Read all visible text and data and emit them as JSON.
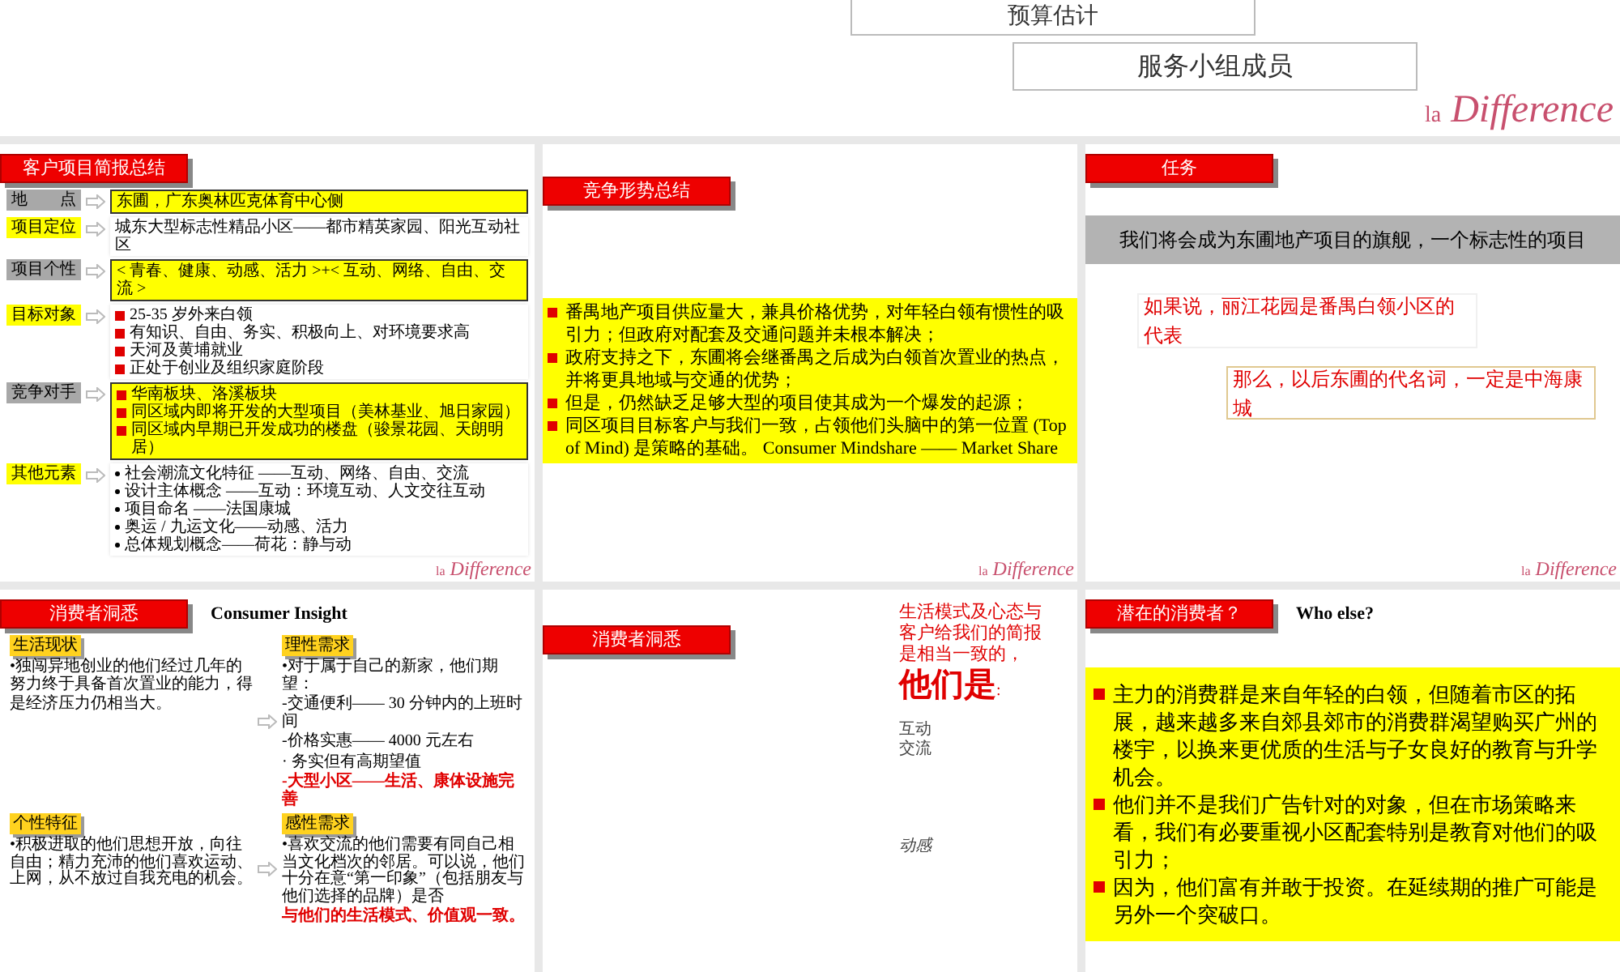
{
  "top_slide": {
    "boxes": [
      "预算估计",
      "服务小组成员"
    ],
    "logo": {
      "prefix": "la",
      "word": "Difference"
    }
  },
  "slides": [
    {
      "kind": "brief",
      "title": "客户项目简报总结",
      "logo": {
        "prefix": "la",
        "word": "Difference"
      },
      "rows": [
        {
          "label": "地　　点",
          "highlight": true,
          "kind": "plain",
          "lines": [
            "东圃，广东奥林匹克体育中心侧"
          ]
        },
        {
          "label": "项目定位",
          "highlight": false,
          "kind": "plain",
          "lines": [
            "城东大型标志性精品小区——都市精英家园、阳光互动社区"
          ]
        },
        {
          "label": "项目个性",
          "highlight": true,
          "kind": "plain",
          "lines": [
            "< 青春、健康、动感、活力 >+< 互动、网络、自由、交流 >"
          ]
        },
        {
          "label": "目标对象",
          "highlight": false,
          "kind": "square",
          "lines": [
            "25-35 岁外来白领",
            "有知识、自由、务实、积极向上、对环境要求高",
            "天河及黄埔就业",
            "正处于创业及组织家庭阶段"
          ]
        },
        {
          "label": "竞争对手",
          "highlight": true,
          "kind": "square",
          "lines": [
            "华南板块、洛溪板块",
            "同区域内即将开发的大型项目（美林基业、旭日家园）",
            "同区域内早期已开发成功的楼盘（骏景花园、天朗明居）"
          ]
        },
        {
          "label": "其他元素",
          "highlight": false,
          "kind": "dot",
          "lines": [
            "社会潮流文化特征 ——互动、网络、自由、交流",
            "设计主体概念 ——互动：环境互动、人文交往互动",
            "项目命名 ——法国康城",
            "奥运 / 九运文化——动感、活力",
            "总体规划概念——荷花：静与动"
          ]
        }
      ]
    },
    {
      "kind": "bullets",
      "title": "竞争形势总结",
      "logo": {
        "prefix": "la",
        "word": "Difference"
      },
      "items": [
        "番禺地产项目供应量大，兼具价格优势，对年轻白领有惯性的吸引力；但政府对配套及交通问题并未根本解决；",
        "政府支持之下，东圃将会继番禺之后成为白领首次置业的热点，并将更具地域与交通的优势；",
        "但是，仍然缺乏足够大型的项目使其成为一个爆发的起源；",
        "同区项目目标客户与我们一致，占领他们头脑中的第一位置 (Top of Mind) 是策略的基础。 Consumer Mindshare —— Market Share"
      ]
    },
    {
      "kind": "task",
      "title": "任务",
      "logo": {
        "prefix": "la",
        "word": "Difference"
      },
      "banner": "我们将会成为东圃地产项目的旗舰，一个标志性的项目",
      "statements": [
        "如果说，丽江花园是番禺白领小区的代表",
        "那么，以后东圃的代名词，一定是中海康城"
      ]
    },
    {
      "kind": "insight",
      "title": "消费者洞悉",
      "subtitle": "Consumer Insight",
      "quadrants": [
        {
          "tag": "生活现状",
          "lines": [
            {
              "text": "•独闯异地创业的他们经过几年的努力终于具备首次置业的能力，得",
              "red": false
            },
            {
              "text": "是经济压力仍相当大。",
              "red": false
            }
          ]
        },
        {
          "tag": "理性需求",
          "lines": [
            {
              "text": "•对于属于自己的新家，他们期望：",
              "red": false
            },
            {
              "text": "-交通便利—— 30 分钟内的上班时间",
              "red": false
            },
            {
              "text": "-价格实惠—— 4000 元左右",
              "red": false
            },
            {
              "text": "· 务实但有高期望值",
              "red": false
            },
            {
              "text": "-大型小区——生活、康体设施完善",
              "red": true
            }
          ]
        },
        {
          "tag": "个性特征",
          "lines": [
            {
              "text": "•积极进取的他们思想开放，向往自由；精力充沛的他们喜欢运动、上网，从不放过自我充电的机会。",
              "red": false
            }
          ]
        },
        {
          "tag": "感性需求",
          "lines": [
            {
              "text": "•喜欢交流的他们需要有同自己相当文化档次的邻居。可以说，他们十分在意“第一印象”（包括朋友与他们选择的品牌）是否",
              "red": false
            },
            {
              "text": "与他们的生活模式、价值观一致。",
              "red": true
            }
          ]
        }
      ]
    },
    {
      "kind": "statement",
      "title": "消费者洞悉",
      "lead": "生活模式及心态与客户给我们的简报是相当一致的，",
      "emphasis": "他们是",
      "colon": ":",
      "words": [
        {
          "text": "互动",
          "italic": false
        },
        {
          "text": "交流",
          "italic": false
        },
        {
          "text": "动感",
          "italic": true
        }
      ]
    },
    {
      "kind": "bullets",
      "title": "潜在的消费者？",
      "subtitle": "Who else?",
      "items": [
        "主力的消费群是来自年轻的白领，但随着市区的拓展，越来越多来自郊县郊市的消费群渴望购买广州的楼宇，以换来更优质的生活与子女良好的教育与升学机会。",
        "他们并不是我们广告针对的对象，但在市场策略来看，我们有必要重视小区配套特别是教育对他们的吸引力；",
        "因为，他们富有并敢于投资。在延续期的推广可能是另外一个突破口。"
      ]
    }
  ]
}
